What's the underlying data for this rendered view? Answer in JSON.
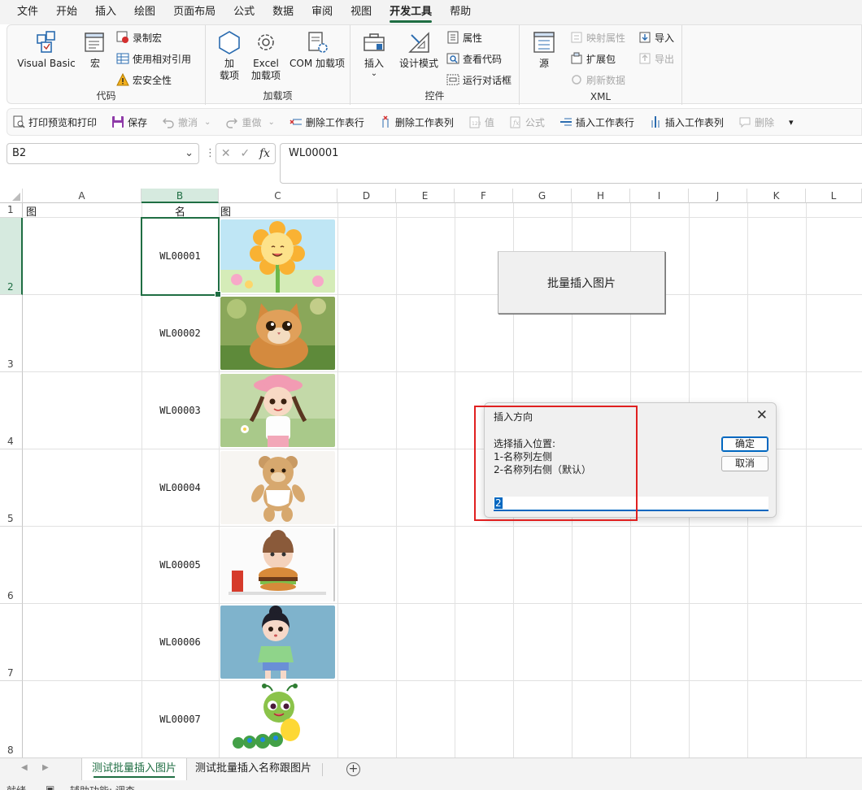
{
  "menu": [
    "文件",
    "开始",
    "插入",
    "绘图",
    "页面布局",
    "公式",
    "数据",
    "审阅",
    "视图",
    "开发工具",
    "帮助"
  ],
  "menu_active": "开发工具",
  "ribbon": {
    "code": {
      "label": "代码",
      "visual_basic": "Visual Basic",
      "macros": "宏",
      "record_macro": "录制宏",
      "relative_ref": "使用相对引用",
      "macro_security": "宏安全性"
    },
    "addins": {
      "label": "加载项",
      "addin": [
        "加",
        "载项"
      ],
      "excel_addin": [
        "Excel",
        "加载项"
      ],
      "com_addin": "COM 加载项"
    },
    "controls": {
      "label": "控件",
      "insert": "插入",
      "design_mode": "设计模式",
      "properties": "属性",
      "view_code": "查看代码",
      "run_dialog": "运行对话框"
    },
    "xml": {
      "label": "XML",
      "source": "源",
      "map_properties": "映射属性",
      "expansion_packs": "扩展包",
      "refresh_data": "刷新数据",
      "import": "导入",
      "export": "导出"
    }
  },
  "qat": {
    "print_preview": "打印预览和打印",
    "save": "保存",
    "undo": "撤消",
    "redo": "重做",
    "delete_rows": "删除工作表行",
    "delete_cols": "删除工作表列",
    "value": "值",
    "formula": "公式",
    "insert_rows": "插入工作表行",
    "insert_cols": "插入工作表列",
    "delete": "删除"
  },
  "namebox": "B2",
  "formula": "WL00001",
  "columns": [
    "A",
    "B",
    "C",
    "D",
    "E",
    "F",
    "G",
    "H",
    "I",
    "J",
    "K",
    "L"
  ],
  "rows": [
    "1",
    "2",
    "3",
    "4",
    "5",
    "6",
    "7",
    "8"
  ],
  "header_row": {
    "a": "图",
    "b": "名",
    "c": "图"
  },
  "names": [
    "WL00001",
    "WL00002",
    "WL00003",
    "WL00004",
    "WL00005",
    "WL00006",
    "WL00007"
  ],
  "pictures": [
    "sunflower",
    "kitten",
    "girl-pink-hat",
    "teddy-bear",
    "girl-burger",
    "girl-green-shirt",
    "caterpillar"
  ],
  "macro_button": "批量插入图片",
  "dialog": {
    "title": "插入方向",
    "prompt": [
      "选择插入位置:",
      "1-名称列左侧",
      "2-名称列右侧（默认）"
    ],
    "ok": "确定",
    "cancel": "取消",
    "input_value": "2"
  },
  "sheets": [
    "测试批量插入图片",
    "测试批量插入名称跟图片"
  ],
  "active_sheet": "测试批量插入图片",
  "status": [
    "就绪",
    "辅助功能: 调查"
  ],
  "colors": {
    "accent": "#1f6e43",
    "highlight": "#e02020",
    "dialog_focus": "#0067c0"
  }
}
